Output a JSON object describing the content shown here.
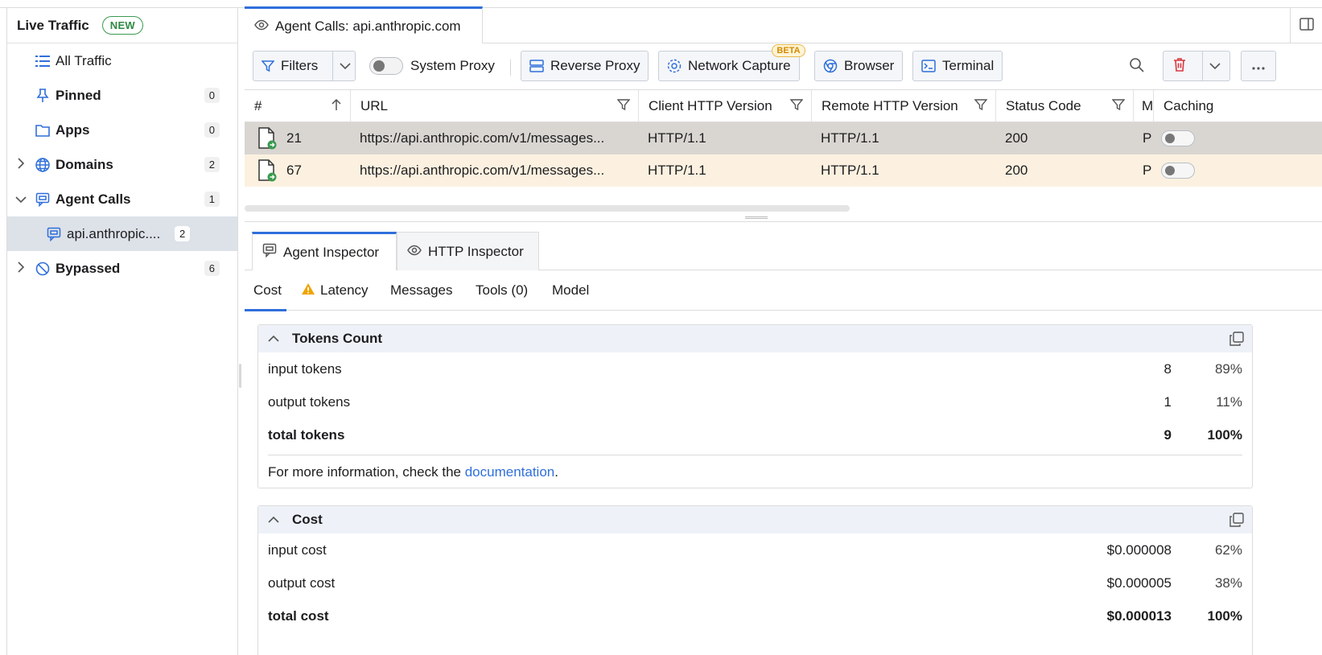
{
  "sidebar": {
    "title": "Live Traffic",
    "new_badge": "NEW",
    "items": [
      {
        "label": "All Traffic",
        "count": ""
      },
      {
        "label": "Pinned",
        "count": "0"
      },
      {
        "label": "Apps",
        "count": "0"
      },
      {
        "label": "Domains",
        "count": "2"
      },
      {
        "label": "Agent Calls",
        "count": "1"
      },
      {
        "label": "api.anthropic....",
        "count": "2"
      },
      {
        "label": "Bypassed",
        "count": "6"
      }
    ]
  },
  "tab": {
    "title": "Agent Calls: api.anthropic.com"
  },
  "toolbar": {
    "filters_label": "Filters",
    "system_proxy_label": "System Proxy",
    "reverse_proxy_label": "Reverse Proxy",
    "network_capture_label": "Network Capture",
    "beta_badge": "BETA",
    "browser_label": "Browser",
    "terminal_label": "Terminal"
  },
  "table": {
    "columns": [
      "#",
      "URL",
      "Client HTTP Version",
      "Remote HTTP Version",
      "Status Code",
      "M",
      "Caching"
    ],
    "rows": [
      {
        "id": "21",
        "url": "https://api.anthropic.com/v1/messages...",
        "client_http": "HTTP/1.1",
        "remote_http": "HTTP/1.1",
        "status": "200",
        "m": "P"
      },
      {
        "id": "67",
        "url": "https://api.anthropic.com/v1/messages...",
        "client_http": "HTTP/1.1",
        "remote_http": "HTTP/1.1",
        "status": "200",
        "m": "P"
      }
    ]
  },
  "inspector": {
    "tabs": [
      "Agent Inspector",
      "HTTP Inspector"
    ],
    "subtabs": [
      "Cost",
      "Latency",
      "Messages",
      "Tools (0)",
      "Model"
    ]
  },
  "tokens": {
    "title": "Tokens Count",
    "rows": [
      {
        "label": "input tokens",
        "value": "8",
        "pct": "89%"
      },
      {
        "label": "output tokens",
        "value": "1",
        "pct": "11%"
      },
      {
        "label": "total tokens",
        "value": "9",
        "pct": "100%"
      }
    ],
    "note_prefix": "For more information, check the ",
    "note_link": "documentation",
    "note_suffix": "."
  },
  "cost": {
    "title": "Cost",
    "rows": [
      {
        "label": "input cost",
        "value": "$0.000008",
        "pct": "62%"
      },
      {
        "label": "output cost",
        "value": "$0.000005",
        "pct": "38%"
      },
      {
        "label": "total cost",
        "value": "$0.000013",
        "pct": "100%"
      }
    ]
  },
  "colors": {
    "accent": "#2f6fdb",
    "new_badge": "#2f8a44",
    "selected_row": "#d9d6d2",
    "highlight_row": "#fcf1e0",
    "delete": "#d9363e",
    "warning": "#f0a400"
  }
}
